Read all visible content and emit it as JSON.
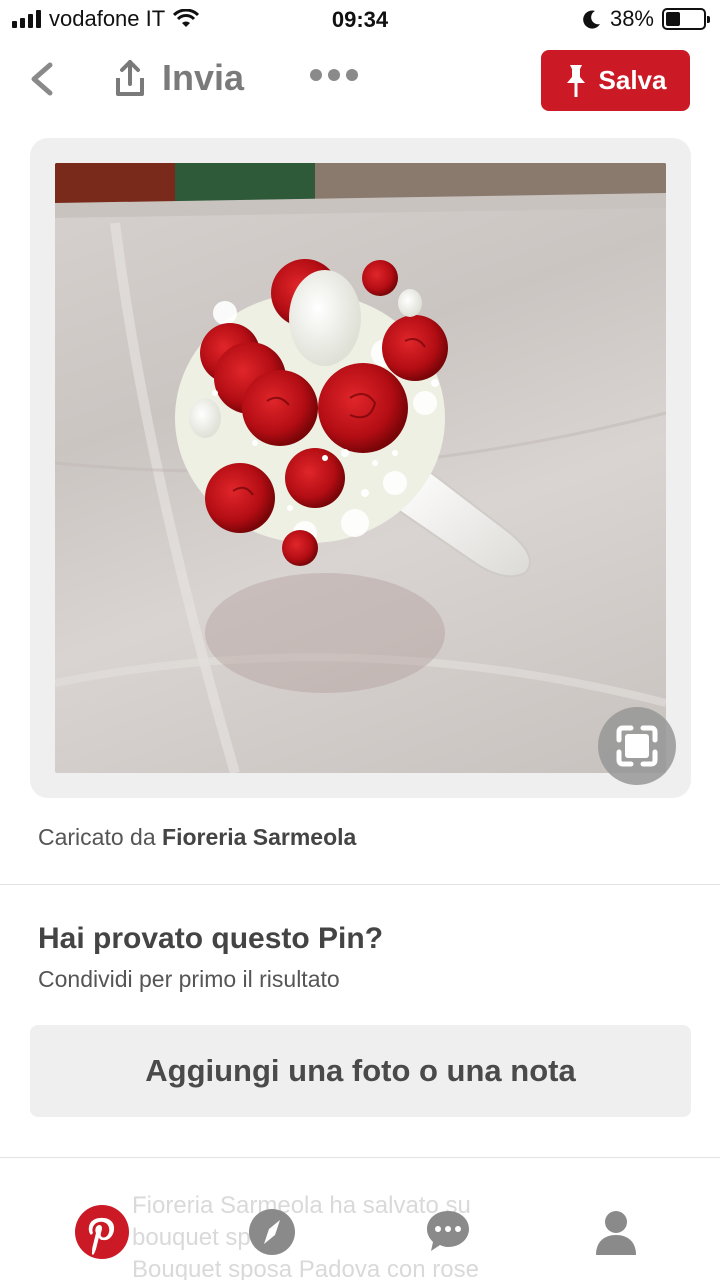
{
  "status": {
    "carrier": "vodafone IT",
    "time": "09:34",
    "battery": "38%",
    "battery_level": 0.38
  },
  "toolbar": {
    "share_label": "Invia",
    "save_label": "Salva"
  },
  "pin": {
    "uploaded_prefix": "Caricato da",
    "uploader": "Fioreria Sarmeola"
  },
  "tried": {
    "title": "Hai provato questo Pin?",
    "subtitle": "Condividi per primo il risultato",
    "button_label": "Aggiungi una foto o una nota"
  },
  "background_text": {
    "line1": "Fioreria Sarmeola ha salvato su",
    "line2": "bouquet sposa",
    "line3": "Bouquet sposa Padova con rose"
  },
  "colors": {
    "brand_red": "#cb1a25",
    "icon_gray": "#8a8a8a"
  }
}
